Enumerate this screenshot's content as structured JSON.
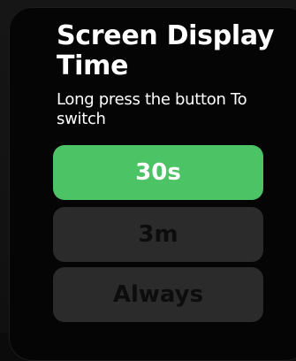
{
  "screen": {
    "title": "Screen Display Time",
    "subtitle": "Long press the button To switch"
  },
  "options": [
    {
      "label": "30s",
      "selected": true
    },
    {
      "label": "3m",
      "selected": false
    },
    {
      "label": "Always",
      "selected": false
    }
  ],
  "colors": {
    "selected": "#4cc466",
    "unselected": "#2b2b2b",
    "background": "#050505",
    "text": "#ffffff"
  }
}
